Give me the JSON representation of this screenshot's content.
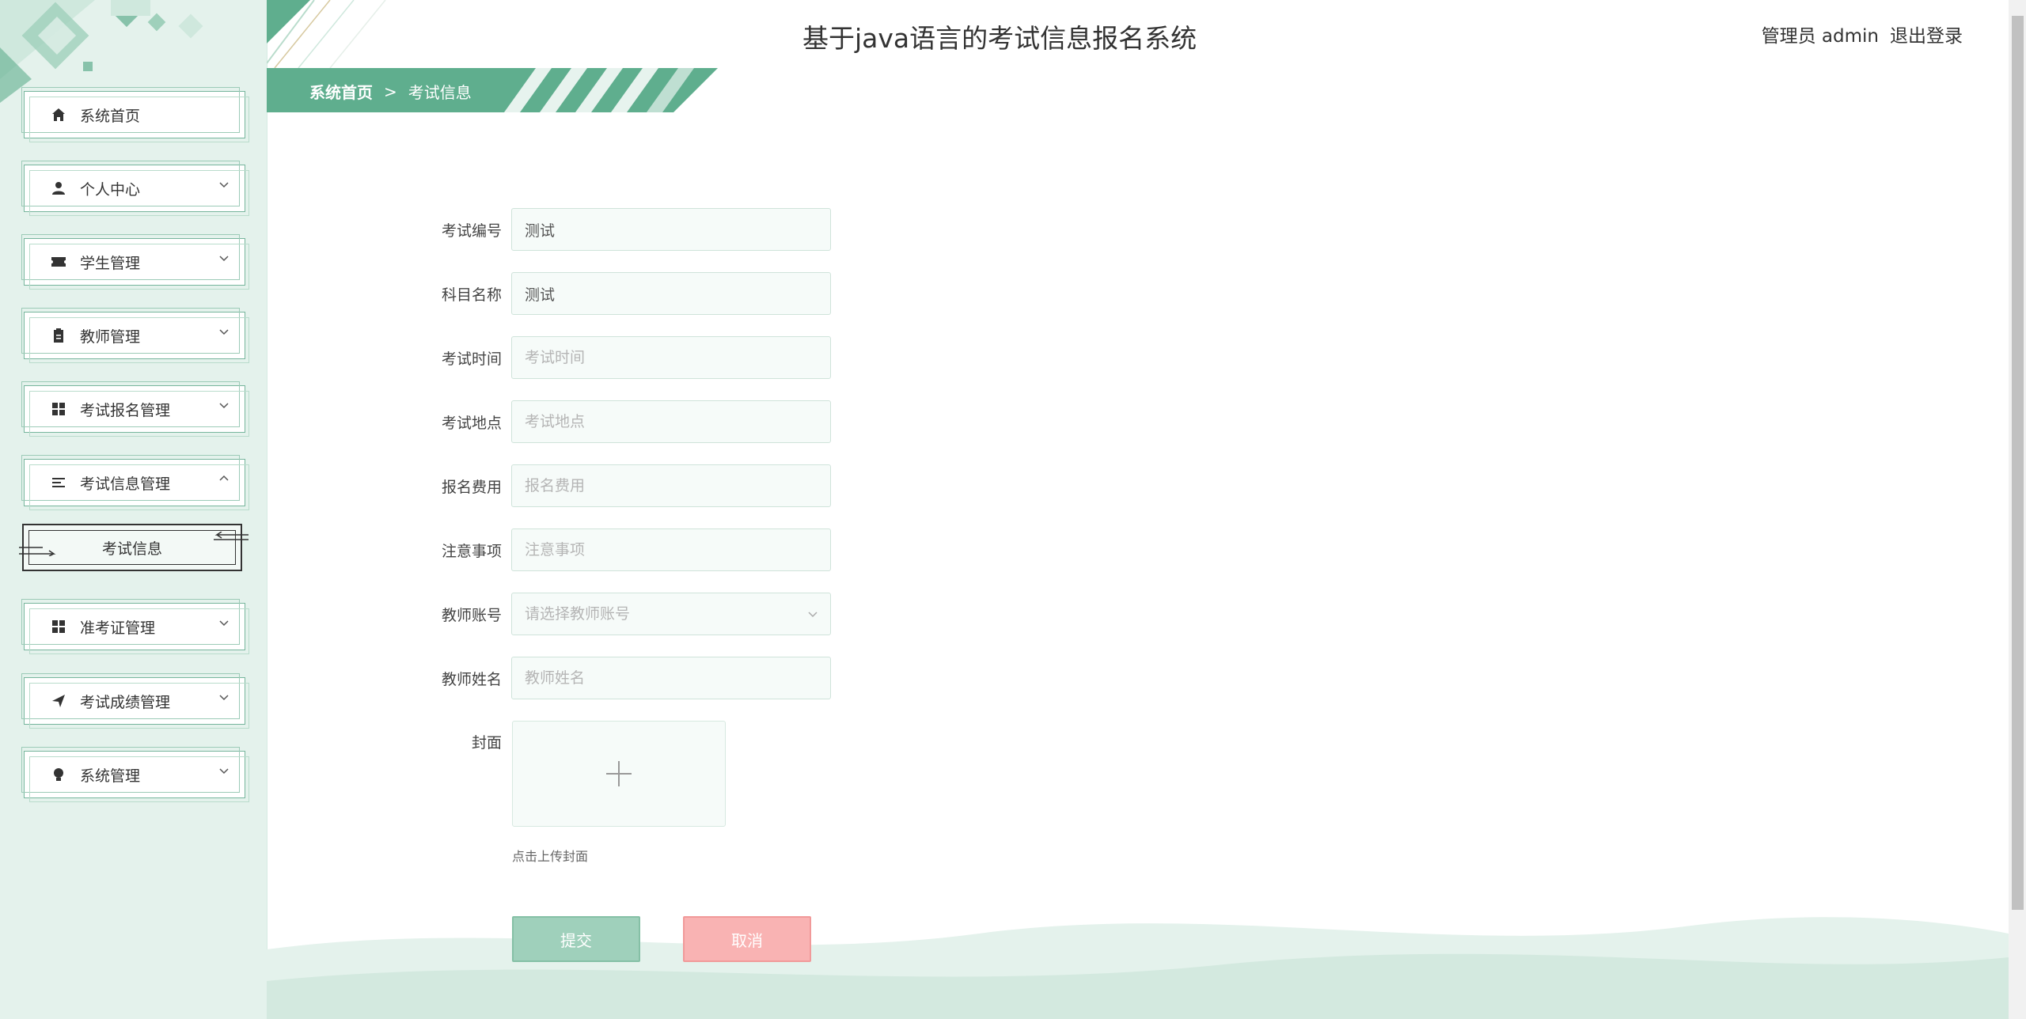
{
  "header": {
    "title": "基于java语言的考试信息报名系统",
    "user_label": "管理员 admin",
    "logout_label": "退出登录"
  },
  "breadcrumb": {
    "home": "系统首页",
    "separator": ">",
    "current": "考试信息"
  },
  "sidebar": {
    "items": [
      {
        "label": "系统首页",
        "icon": "home-icon"
      },
      {
        "label": "个人中心",
        "icon": "user-icon"
      },
      {
        "label": "学生管理",
        "icon": "ticket-icon"
      },
      {
        "label": "教师管理",
        "icon": "clipboard-icon"
      },
      {
        "label": "考试报名管理",
        "icon": "grid-icon"
      },
      {
        "label": "考试信息管理",
        "icon": "list-icon"
      },
      {
        "label": "准考证管理",
        "icon": "grid-icon"
      },
      {
        "label": "考试成绩管理",
        "icon": "send-icon"
      },
      {
        "label": "系统管理",
        "icon": "bulb-icon"
      }
    ],
    "sub_item": {
      "label": "考试信息"
    }
  },
  "form": {
    "exam_no": {
      "label": "考试编号",
      "value": "测试"
    },
    "subject": {
      "label": "科目名称",
      "value": "测试"
    },
    "exam_time": {
      "label": "考试时间",
      "placeholder": "考试时间"
    },
    "exam_place": {
      "label": "考试地点",
      "placeholder": "考试地点"
    },
    "fee": {
      "label": "报名费用",
      "placeholder": "报名费用"
    },
    "notice": {
      "label": "注意事项",
      "placeholder": "注意事项"
    },
    "teacher_account": {
      "label": "教师账号",
      "placeholder": "请选择教师账号"
    },
    "teacher_name": {
      "label": "教师姓名",
      "placeholder": "教师姓名"
    },
    "cover": {
      "label": "封面",
      "hint": "点击上传封面"
    }
  },
  "buttons": {
    "submit": "提交",
    "cancel": "取消"
  },
  "colors": {
    "accent": "#5fae8e",
    "sidebar_bg": "#e4f2ec",
    "cancel": "#f9b3b3",
    "submit": "#9fd0bb"
  }
}
